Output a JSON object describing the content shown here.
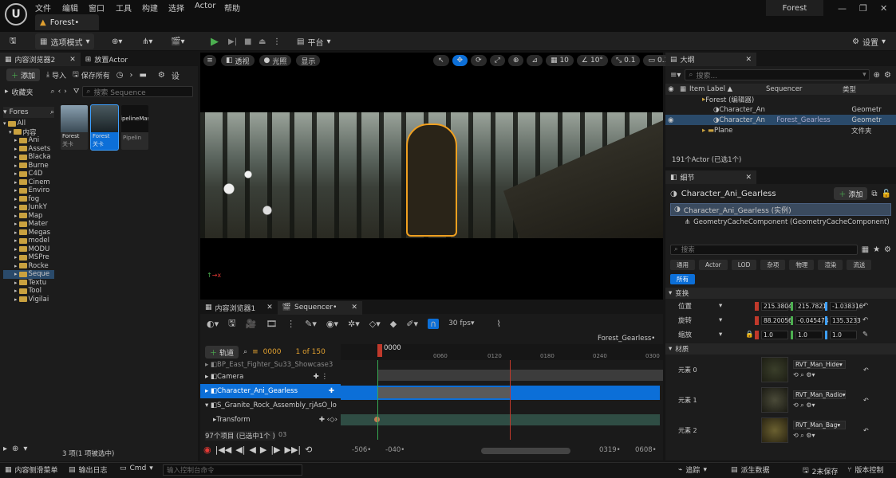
{
  "app": {
    "title_tab": "Forest•",
    "project_name": "Forest",
    "menu": [
      "文件",
      "编辑",
      "窗口",
      "工具",
      "构建",
      "选择",
      "Actor",
      "帮助"
    ]
  },
  "toolbar": {
    "mode_label": "选项模式",
    "platform_label": "平台",
    "settings_label": "设置"
  },
  "content_browser": {
    "tab1": "内容浏览器2",
    "tab2": "放置Actor",
    "add_label": "添加",
    "import_label": "导入",
    "save_all_label": "保存所有",
    "settings_label": "设",
    "favorites_label": "收藏夹",
    "forest_label": "Fores",
    "search_placeholder": "搜索 Sequence",
    "tree": [
      "All",
      "内容",
      "Ani",
      "Assets",
      "Blacka",
      "Burne",
      "C4D",
      "Cinem",
      "Enviro",
      "fog",
      "JunkY",
      "Map",
      "Mater",
      "Megas",
      "model",
      "MODU",
      "MSPre",
      "Rocke",
      "Seque",
      "Textu",
      "Tool",
      "Vigilai"
    ],
    "selected_folder": "Seque",
    "assets": [
      {
        "label": "Forest",
        "sub": "关卡"
      },
      {
        "label": "Forest",
        "sub": "关卡"
      },
      {
        "label": "PipelineMast",
        "sub": "Pipelin"
      }
    ],
    "status": "3 项(1 项被选中)"
  },
  "viewport": {
    "perspective_label": "透视",
    "lit_label": "光照",
    "show_label": "显示",
    "grid_value": "10",
    "angle_value": "10°",
    "scale_value": "0.1",
    "camera_speed": "0.33"
  },
  "sequencer": {
    "tab1": "内容浏览器1",
    "tab2": "Sequencer•",
    "track_btn": "轨道",
    "current_frame": "0000",
    "frame_of": "1 of 150",
    "fps": "30 fps",
    "sequence_name": "Forest_Gearless•",
    "ruler_labels": [
      "0000",
      "0060",
      "0120",
      "0180",
      "0240",
      "0300"
    ],
    "tracks": [
      "BP_East_Fighter_Su33_Showcase3",
      "Camera",
      "Character_Ani_Gearless",
      "S_Granite_Rock_Assembly_rjAsO_lo",
      "Transform"
    ],
    "tooltip": "97个项目 (已选中1个 )",
    "row_tail": "03",
    "range_labels": [
      "-506•",
      "-040•",
      "0319•",
      "0608•"
    ]
  },
  "outliner": {
    "title": "大纲",
    "search_placeholder": "搜索...",
    "col_label": "Item Label ▲",
    "col_sequencer": "Sequencer",
    "col_type": "类型",
    "rows": [
      {
        "label": "Forest (编辑器)",
        "seq": "",
        "type": ""
      },
      {
        "label": "Character_An",
        "seq": "",
        "type": "Geometr"
      },
      {
        "label": "Character_An",
        "seq": "Forest_Gearless",
        "type": "Geometr"
      },
      {
        "label": "Plane",
        "seq": "",
        "type": "文件夹"
      }
    ],
    "count": "191个Actor (已选1个)"
  },
  "details": {
    "title": "细节",
    "actor_name": "Character_Ani_Gearless",
    "add_label": "添加",
    "instance_label": "Character_Ani_Gearless (实例)",
    "component": "GeometryCacheComponent (GeometryCacheComponent)",
    "component_tail": "在C",
    "search_placeholder": "搜索",
    "categories": [
      "通用",
      "Actor",
      "LOD",
      "杂项",
      "物理",
      "渲染",
      "流送",
      "所有"
    ],
    "transform_section": "变换",
    "location_label": "位置",
    "rotation_label": "旋转",
    "scale_label": "缩放",
    "location": [
      "215.3804",
      "215.7821",
      "-1.038316"
    ],
    "rotation": [
      "88.20056",
      "-0.045474",
      "135.3233"
    ],
    "scale": [
      "1.0",
      "1.0",
      "1.0"
    ],
    "materials_section": "材质",
    "elements": [
      {
        "label": "元素 0",
        "material": "RVT_Man_Hide"
      },
      {
        "label": "元素 1",
        "material": "RVT_Man_Radio"
      },
      {
        "label": "元素 2",
        "material": "RVT_Man_Bag"
      }
    ]
  },
  "statusbar": {
    "drawer": "内容侧滑菜单",
    "output_log": "输出日志",
    "cmd": "Cmd",
    "cmd_placeholder": "输入控制台命令",
    "trace": "追踪",
    "derived_data": "派生数据",
    "unsaved": "2未保存",
    "source_control": "版本控制"
  }
}
